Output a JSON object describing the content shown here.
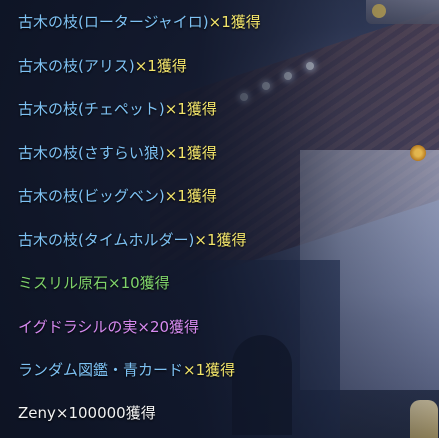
{
  "colors": {
    "item_blue": "#7ec2f4",
    "obtain_yellow": "#f2e46a",
    "mithril_green": "#7fd36a",
    "yggdrasil_purple": "#d68af0",
    "zeny_white": "#f2f2f2"
  },
  "log": {
    "entries": [
      {
        "item": "古木の枝(ロータージャイロ)",
        "suffix": "×1獲得"
      },
      {
        "item": "古木の枝(アリス)",
        "suffix": "×1獲得"
      },
      {
        "item": "古木の枝(チェペット)",
        "suffix": "×1獲得"
      },
      {
        "item": "古木の枝(さすらい狼)",
        "suffix": "×1獲得"
      },
      {
        "item": "古木の枝(ビッグベン)",
        "suffix": "×1獲得"
      },
      {
        "item": "古木の枝(タイムホルダー)",
        "suffix": "×1獲得"
      },
      {
        "item": "ミスリル原石×10獲得",
        "suffix": ""
      },
      {
        "item": "イグドラシルの実×20獲得",
        "suffix": ""
      },
      {
        "item": "ランダム図鑑・青カード",
        "suffix": "×1獲得"
      },
      {
        "item": "Zeny×100000獲得",
        "suffix": ""
      }
    ]
  }
}
